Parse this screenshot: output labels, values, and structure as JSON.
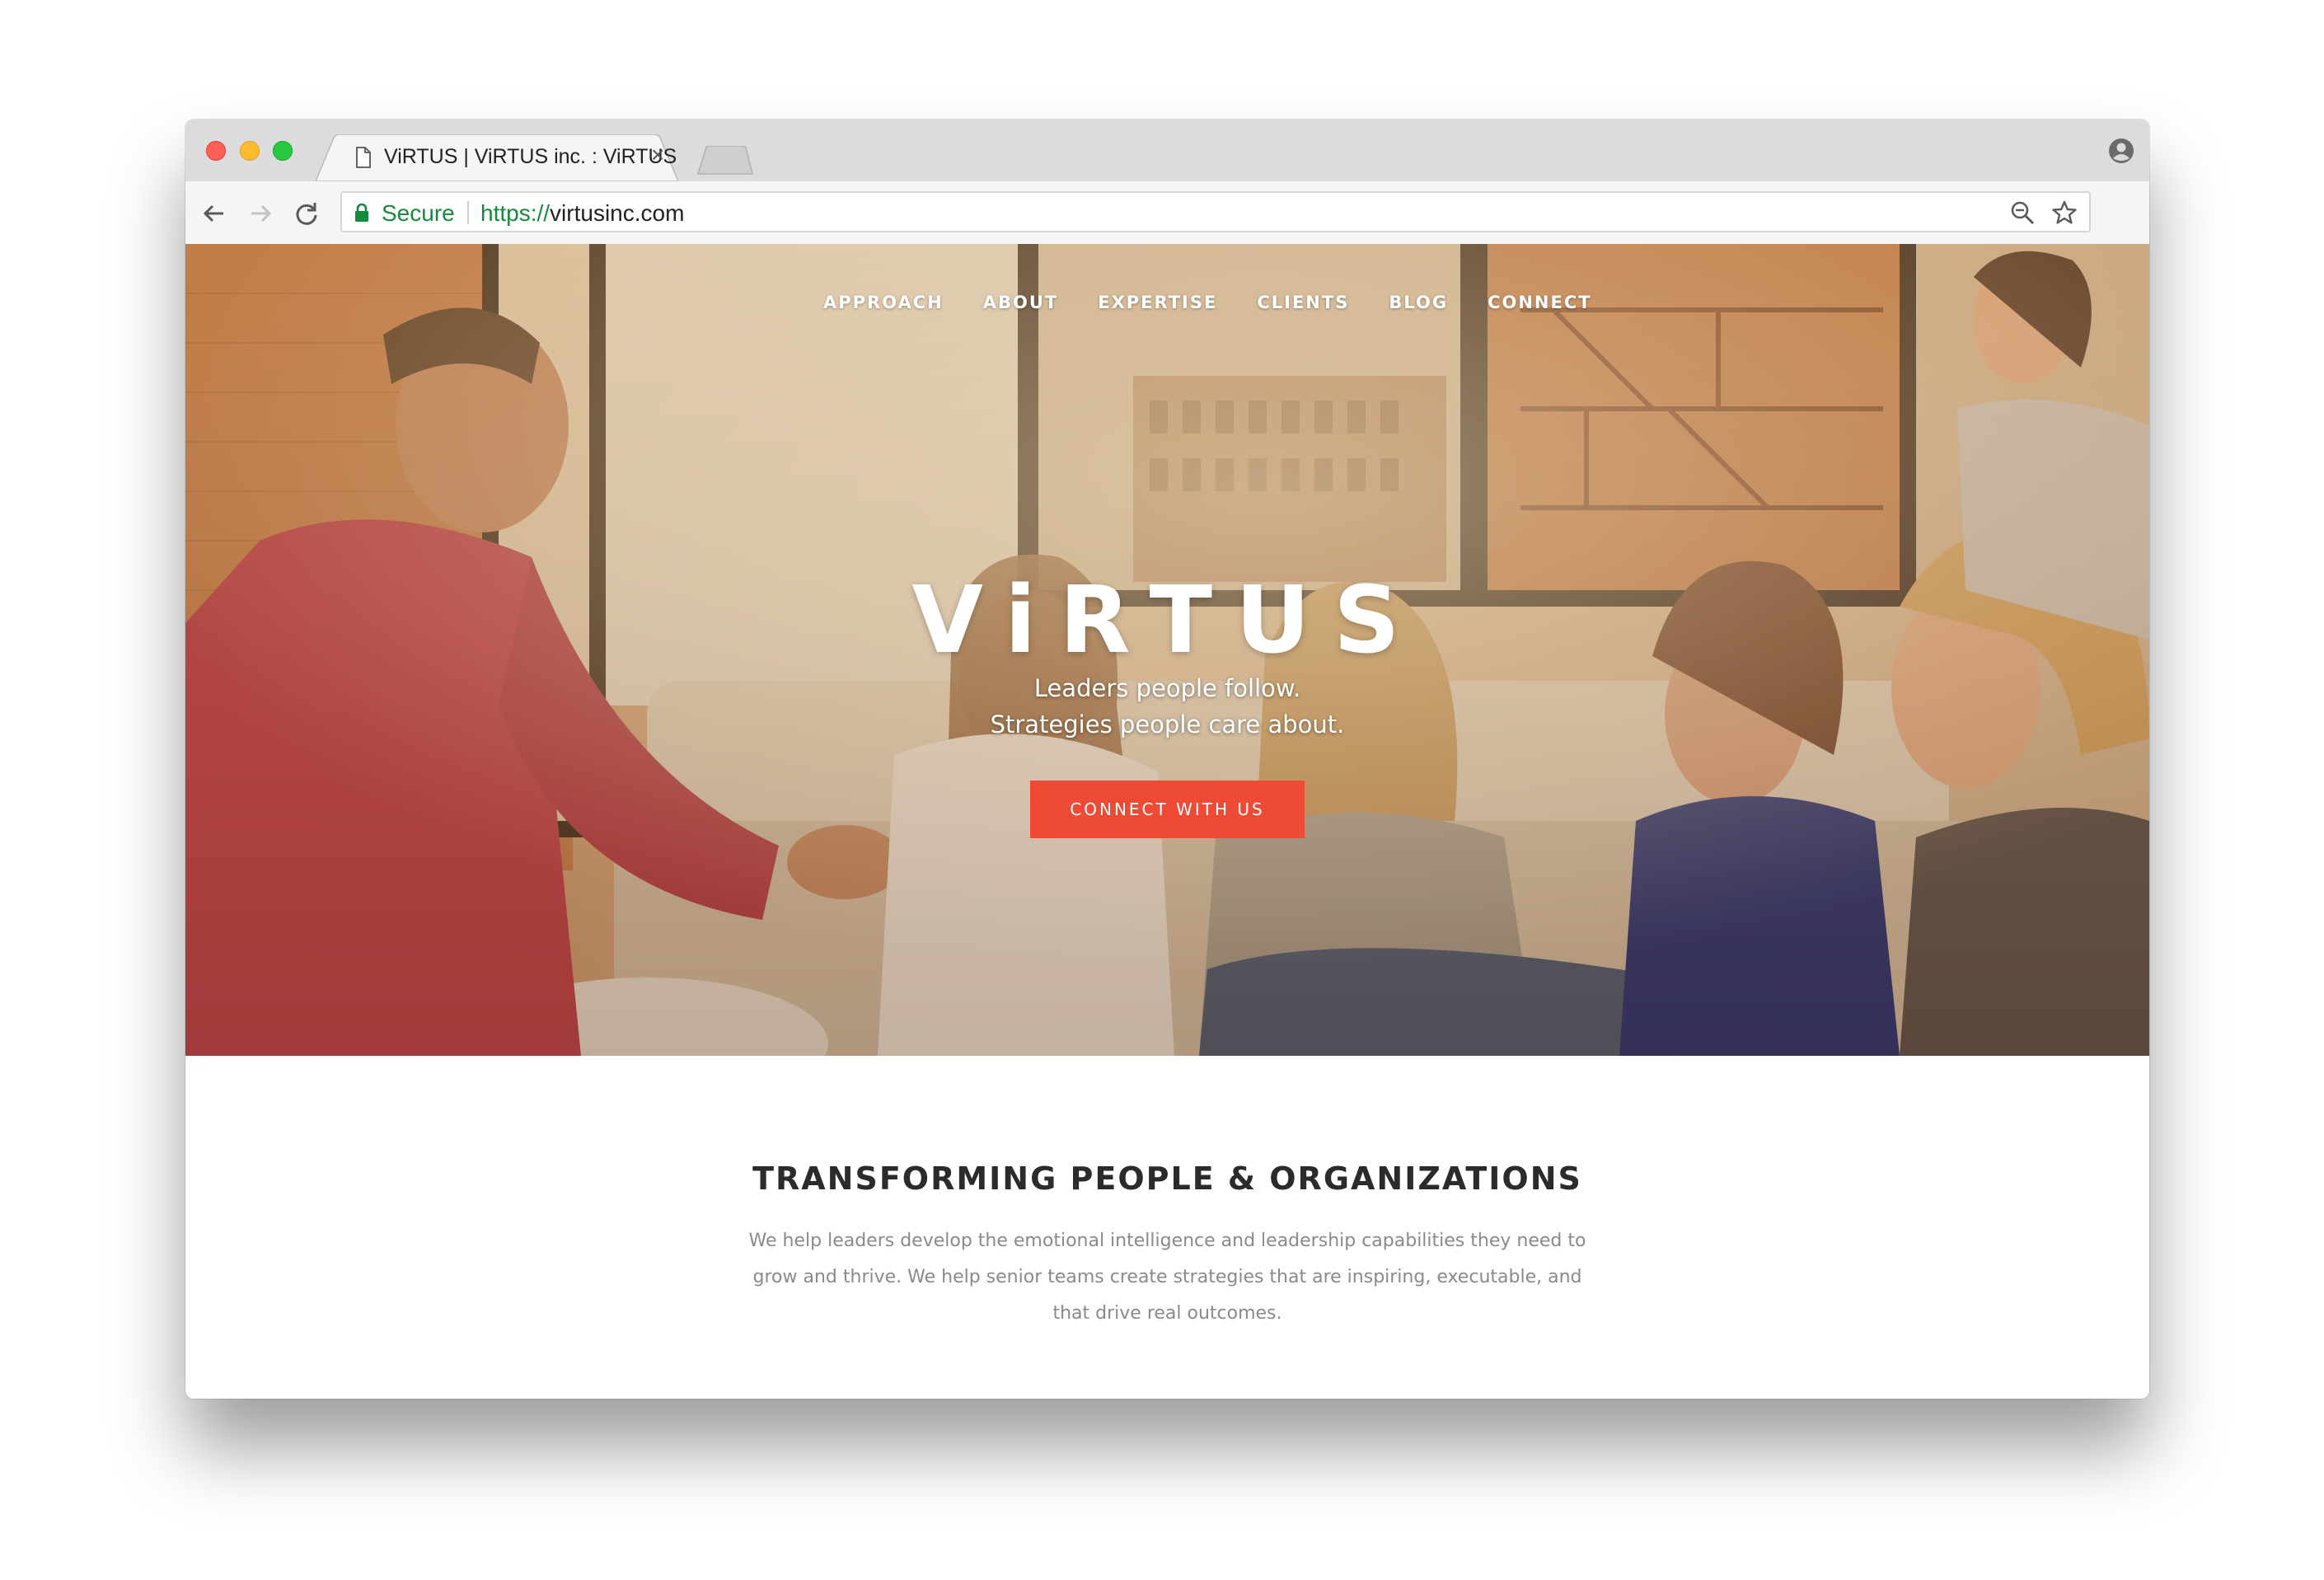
{
  "browser": {
    "tab_title": "ViRTUS | ViRTUS inc. : ViRTUS",
    "tab_close": "×",
    "secure_label": "Secure",
    "url_scheme": "https://",
    "url_host": "virtusinc.com"
  },
  "nav": {
    "items": [
      "APPROACH",
      "ABOUT",
      "EXPERTISE",
      "CLIENTS",
      "BLOG",
      "CONNECT"
    ]
  },
  "hero": {
    "logo": "ViRTUS",
    "tagline_line1": "Leaders people follow.",
    "tagline_line2": "Strategies people care about.",
    "cta_label": "CONNECT WITH US"
  },
  "intro": {
    "heading": "TRANSFORMING PEOPLE & ORGANIZATIONS",
    "body_line1": "We help leaders develop the emotional intelligence and leadership capabilities they need to",
    "body_line2": "grow and thrive.  We help senior teams create strategies that are inspiring, executable, and",
    "body_line3": "that drive real outcomes."
  },
  "colors": {
    "accent": "#ee4a35",
    "secure_green": "#168a3c",
    "heading": "#2b2b2b",
    "body_text": "#8a8a8a"
  },
  "icons": {
    "tab": "document-icon",
    "toolbar": [
      "back-arrow-icon",
      "forward-arrow-icon",
      "reload-icon",
      "lock-icon",
      "zoom-icon",
      "star-icon",
      "profile-icon"
    ]
  }
}
